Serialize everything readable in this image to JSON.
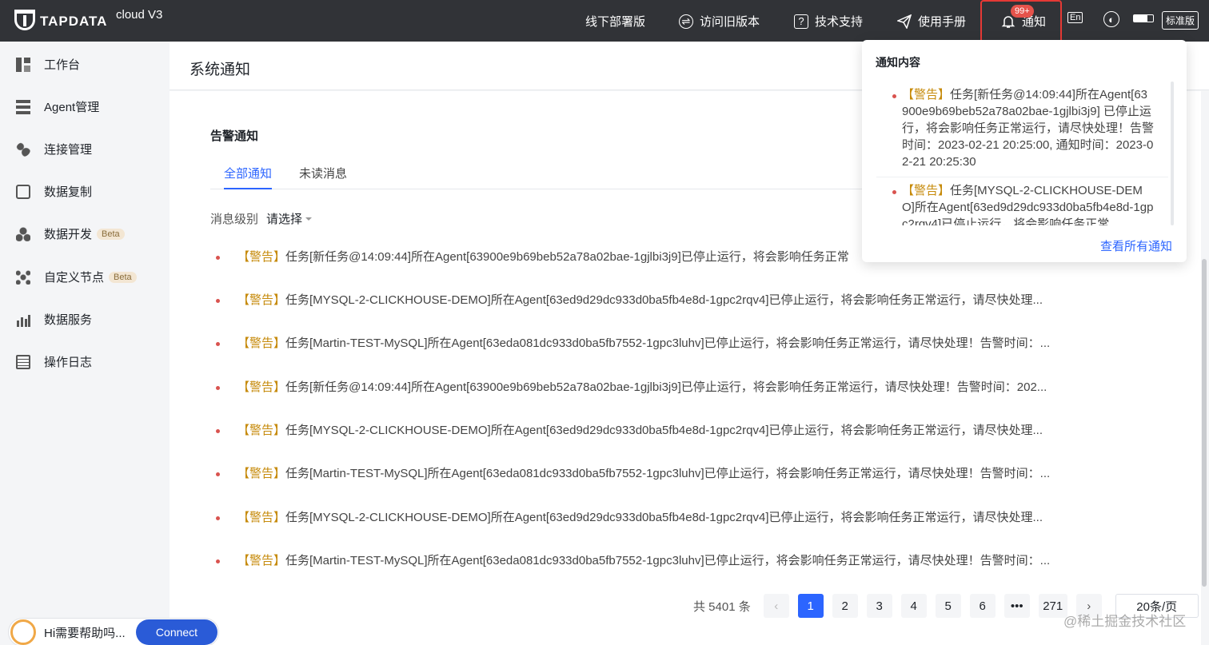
{
  "topbar": {
    "logo_text": "TAPDATA",
    "logo_version": "cloud V3",
    "nav": {
      "offline": "线下部署版",
      "old_version": "访问旧版本",
      "support": "技术支持",
      "manual": "使用手册",
      "notify": "通知"
    },
    "badge": "99+",
    "lang_icon_text": "En",
    "plan_label": "标准版"
  },
  "sidebar": {
    "items": [
      {
        "label": "工作台"
      },
      {
        "label": "Agent管理"
      },
      {
        "label": "连接管理"
      },
      {
        "label": "数据复制"
      },
      {
        "label": "数据开发",
        "badge": "Beta"
      },
      {
        "label": "自定义节点",
        "badge": "Beta"
      },
      {
        "label": "数据服务"
      },
      {
        "label": "操作日志"
      }
    ]
  },
  "page": {
    "title": "系统通知",
    "section_title": "告警通知",
    "tabs": {
      "all": "全部通知",
      "unread": "未读消息"
    },
    "filter": {
      "label": "消息级别",
      "placeholder": "请选择"
    }
  },
  "messages": {
    "tag": "【警告】",
    "rows": [
      "任务[新任务@14:09:44]所在Agent[63900e9b69beb52a78a02bae-1gjlbi3j9]已停止运行，将会影响任务正常",
      "任务[MYSQL-2-CLICKHOUSE-DEMO]所在Agent[63ed9d29dc933d0ba5fb4e8d-1gpc2rqv4]已停止运行，将会影响任务正常运行，请尽快处理...",
      "任务[Martin-TEST-MySQL]所在Agent[63eda081dc933d0ba5fb7552-1gpc3luhv]已停止运行，将会影响任务正常运行，请尽快处理！告警时间：...",
      "任务[新任务@14:09:44]所在Agent[63900e9b69beb52a78a02bae-1gjlbi3j9]已停止运行，将会影响任务正常运行，请尽快处理！告警时间：202...",
      "任务[MYSQL-2-CLICKHOUSE-DEMO]所在Agent[63ed9d29dc933d0ba5fb4e8d-1gpc2rqv4]已停止运行，将会影响任务正常运行，请尽快处理...",
      "任务[Martin-TEST-MySQL]所在Agent[63eda081dc933d0ba5fb7552-1gpc3luhv]已停止运行，将会影响任务正常运行，请尽快处理！告警时间：...",
      "任务[MYSQL-2-CLICKHOUSE-DEMO]所在Agent[63ed9d29dc933d0ba5fb4e8d-1gpc2rqv4]已停止运行，将会影响任务正常运行，请尽快处理...",
      "任务[Martin-TEST-MySQL]所在Agent[63eda081dc933d0ba5fb7552-1gpc3luhv]已停止运行，将会影响任务正常运行，请尽快处理！告警时间：..."
    ]
  },
  "pagination": {
    "total": "共 5401 条",
    "pages": [
      "1",
      "2",
      "3",
      "4",
      "5",
      "6",
      "•••",
      "271"
    ],
    "prev": "‹",
    "next": "›",
    "page_size": "20条/页"
  },
  "popup": {
    "title": "通知内容",
    "items": [
      {
        "tag": "【警告】",
        "text": "任务[新任务@14:09:44]所在Agent[63900e9b69beb52a78a02bae-1gjlbi3j9] 已停止运行，将会影响任务正常运行，请尽快处理！告警时间：2023-02-21 20:25:00, 通知时间：2023-02-21 20:25:30"
      },
      {
        "tag": "【警告】",
        "text": "任务[MYSQL-2-CLICKHOUSE-DEMO]所在Agent[63ed9d29dc933d0ba5fb4e8d-1gpc2rqv4]已停止运行，将会影响任务正常"
      }
    ],
    "view_all": "查看所有通知"
  },
  "chat": {
    "text": "Hi需要帮助吗...",
    "button": "Connect"
  },
  "watermark": "@稀土掘金技术社区",
  "colors": {
    "accent": "#2c65ff",
    "warning": "#c68a0a",
    "topbar": "#313337",
    "alert_dot": "#d9534f"
  }
}
